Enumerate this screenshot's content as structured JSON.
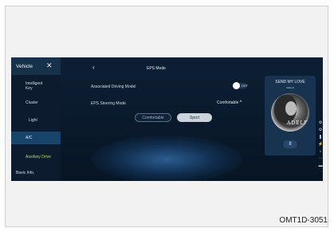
{
  "sidebar": {
    "title": "Vehicle",
    "close_glyph": "✕",
    "items": [
      {
        "label": "Intelligent Key"
      },
      {
        "label": "Cluster"
      },
      {
        "label": "Light"
      },
      {
        "label": "A/C"
      },
      {
        "label": "Auxiliary Drive"
      },
      {
        "label": "Basic Info."
      }
    ]
  },
  "main": {
    "back_glyph": "‹",
    "title": "EPS Mode",
    "associated_label": "Associated Driving Model",
    "toggle_text": "OFF",
    "steering_label": "EPS Steering Mode",
    "steering_value": "Comfortable",
    "steering_chevron": "^",
    "options": [
      {
        "label": "Comfortable"
      },
      {
        "label": "Sport"
      }
    ]
  },
  "media": {
    "song": "SEND MY LOVE",
    "artist": "ADELE",
    "album_text": "ADELE",
    "pause_glyph": "II"
  },
  "side_icons": [
    "⚙",
    "⚙",
    "❚",
    "⚡",
    "☼",
    "⋯",
    "▬"
  ],
  "footer": {
    "code": "OMT1D-3051"
  },
  "colors": {
    "screen_bg": "#0a1a2c",
    "active_item": "#17446a",
    "lime_accent": "#b8d84a"
  }
}
